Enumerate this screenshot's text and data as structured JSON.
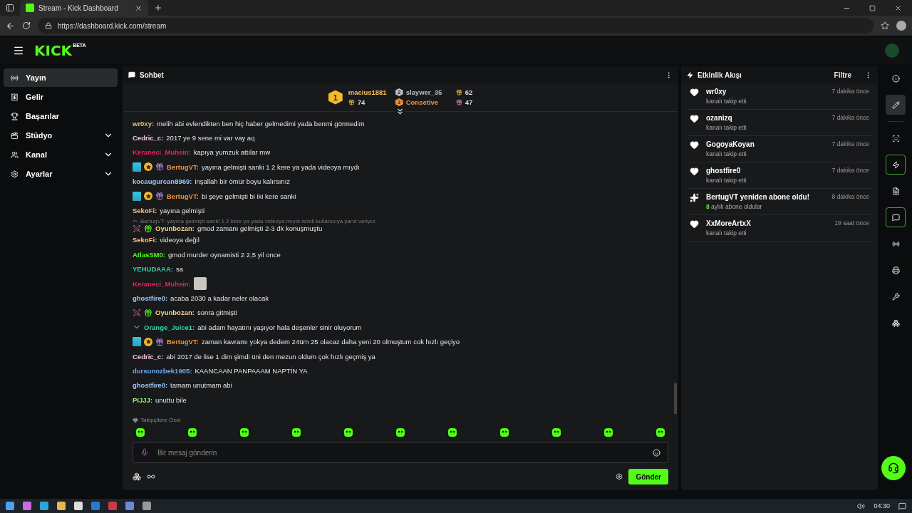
{
  "browser": {
    "tab_title": "Stream - Kick Dashboard",
    "url": "https://dashboard.kick.com/stream"
  },
  "header": {
    "logo": "KICK",
    "logo_tag": "BETA"
  },
  "sidebar": {
    "items": [
      {
        "label": "Yayın",
        "kind": "stream",
        "selected": true,
        "expandable": false
      },
      {
        "label": "Gelir",
        "kind": "revenue",
        "selected": false,
        "expandable": false
      },
      {
        "label": "Başarılar",
        "kind": "trophy",
        "selected": false,
        "expandable": false
      },
      {
        "label": "Stüdyo",
        "kind": "studio",
        "selected": false,
        "expandable": true
      },
      {
        "label": "Kanal",
        "kind": "channel",
        "selected": false,
        "expandable": true
      },
      {
        "label": "Ayarlar",
        "kind": "settings",
        "selected": false,
        "expandable": true
      }
    ]
  },
  "chat": {
    "title": "Sohbet",
    "leaderboard": [
      {
        "rank": "1",
        "name": "macius1881",
        "count": "74",
        "color": "#f5c451"
      },
      {
        "rank": "2",
        "name": "slaywer_35",
        "count": "62",
        "color": "#b9bcc2"
      },
      {
        "rank": "3",
        "name": "Consetive",
        "count": "47",
        "color": "#f0923a"
      }
    ],
    "messages": [
      {
        "user": "wr0xy:",
        "color": "#e8c46a",
        "text": "melih abi evlendikten ben hiç haber gelmedimi yada benmi görmedim"
      },
      {
        "user": "Cedric_c:",
        "color": "#f2c6d8",
        "text": "2017 ye 9 sene mi var vay aq"
      },
      {
        "user": "Keraneci_Muhsin:",
        "color": "#e0245e",
        "text": "kapıya yumzuk attılar mw"
      },
      {
        "user": "BertugVT:",
        "color": "#f0923a",
        "text": "yayına gelmişti sanki 1 2 kere ya yada videoya mıydı",
        "badges": [
          {
            "kind": "og"
          },
          {
            "kind": "rank"
          },
          {
            "kind": "gift"
          }
        ]
      },
      {
        "user": "kocaugurcan8969:",
        "color": "#9cc7f5",
        "text": "inşallah bir ömür boyu kalırsınız"
      },
      {
        "user": "BertugVT:",
        "color": "#f0923a",
        "text": "bi şeye gelmişti bi iki kere sanki",
        "badges": [
          {
            "kind": "og"
          },
          {
            "kind": "rank"
          },
          {
            "kind": "gift"
          }
        ]
      },
      {
        "user": "SekoFi:",
        "color": "#f5c07a",
        "text": "yayına gelmişti"
      },
      {
        "user": "Oyunbozan:",
        "color": "#f5d77a",
        "text": "gmod zamanı gelmişti 2-3 dk konuşmuştu",
        "badges": [
          {
            "kind": "sword"
          },
          {
            "kind": "gift-green"
          }
        ],
        "reply": "BertugVT: yayına gelmişti sanki 1 2 kere ya yada videoya mıydı isimli kullanıcıya yanıt veriyor"
      },
      {
        "user": "SekoFi:",
        "color": "#f5c07a",
        "text": "videoya değil"
      },
      {
        "user": "AtlasSM0:",
        "color": "#53fc18",
        "text": "gmod murder oynamisti 2 2,5 yil once"
      },
      {
        "user": "YEHUDAAA:",
        "color": "#2fd6a8",
        "text": "sa"
      },
      {
        "user": "Keraneci_Muhsin:",
        "color": "#e0245e",
        "emote": true
      },
      {
        "user": "ghostfire0:",
        "color": "#9cc7f5",
        "text": "acaba 2030 a kadar neler olacak"
      },
      {
        "user": "Oyunbozan:",
        "color": "#f5d77a",
        "text": "sonra gitmişti",
        "badges": [
          {
            "kind": "sword"
          },
          {
            "kind": "gift-green"
          }
        ]
      },
      {
        "user": "Orange_Juice1:",
        "color": "#2fd6a8",
        "text": "abi adam hayatını yaşıyor hala deşenler sinir oluyorum",
        "badges": [
          {
            "kind": "chevron"
          }
        ]
      },
      {
        "user": "BertugVT:",
        "color": "#f0923a",
        "text": "zaman kavramı yokya dedem 24üm 25 olacaz daha yeni 20 olmuştum cok hızlı geçiyo",
        "badges": [
          {
            "kind": "og"
          },
          {
            "kind": "rank"
          },
          {
            "kind": "gift"
          }
        ]
      },
      {
        "user": "Cedric_c:",
        "color": "#f2c6d8",
        "text": "abi 2017 de lise 1 dim şimdi üni den mezun oldum çok hızlı geçmiş ya"
      },
      {
        "user": "dursunozbek1905:",
        "color": "#6fa8f5",
        "text": "KAANCAAN PANPAAAM NAPTİN YA"
      },
      {
        "user": "ghostfire0:",
        "color": "#9cc7f5",
        "text": "tamam unutmam abi"
      },
      {
        "user": "PIJJJ:",
        "color": "#9df57a",
        "text": "unuttu bile"
      }
    ],
    "mode_label": "Takipçilere Özel",
    "input": {
      "placeholder": "Bir mesaj gönderin"
    },
    "send_button": "Gönder"
  },
  "events": {
    "title": "Etkinlik Akışı",
    "filter": "Filtre",
    "items": [
      {
        "kind": "follow",
        "name": "wr0xy",
        "detail": "kanalı takip etti",
        "time": "7 dakika önce"
      },
      {
        "kind": "follow",
        "name": "ozanizq",
        "detail": "kanalı takip etti",
        "time": "7 dakika önce"
      },
      {
        "kind": "follow",
        "name": "GogoyaKoyan",
        "detail": "kanalı takip etti",
        "time": "7 dakika önce"
      },
      {
        "kind": "follow",
        "name": "ghostfire0",
        "detail": "kanalı takip etti",
        "time": "7 dakika önce"
      },
      {
        "kind": "resub",
        "name": "BertugVT yeniden abone oldu!",
        "detail": "**8** aylık abone oldular",
        "time": "8 dakika önce"
      },
      {
        "kind": "follow",
        "name": "XxMoreArtxX",
        "detail": "kanalı takip etti",
        "time": "19 saat önce"
      }
    ]
  },
  "rail_top": [
    {
      "kind": "info",
      "selected": false,
      "open": false
    },
    {
      "kind": "edit",
      "selected": true,
      "open": false
    }
  ],
  "rail": [
    {
      "kind": "scan",
      "selected": false,
      "open": false
    },
    {
      "kind": "activity",
      "selected": false,
      "open": true
    },
    {
      "kind": "notes",
      "selected": false,
      "open": false
    },
    {
      "kind": "chat",
      "selected": false,
      "open": true
    },
    {
      "kind": "broadcast",
      "selected": false,
      "open": false
    },
    {
      "kind": "print",
      "selected": false,
      "open": false
    },
    {
      "kind": "tools",
      "selected": false,
      "open": false
    },
    {
      "kind": "apps",
      "selected": false,
      "open": false
    }
  ],
  "taskbar": {
    "time": "04:30"
  }
}
